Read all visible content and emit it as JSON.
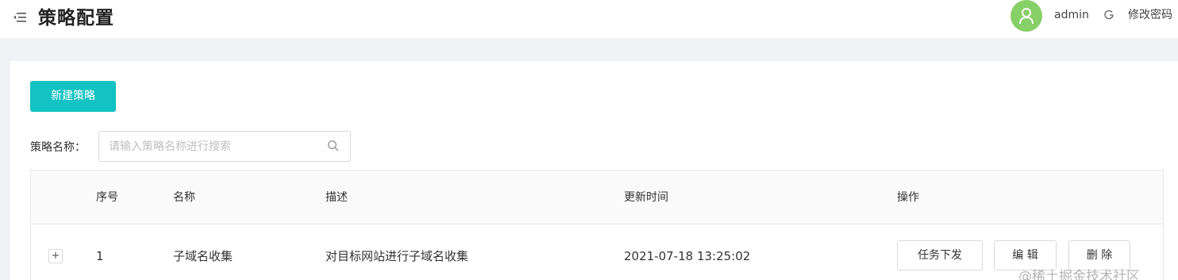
{
  "header": {
    "title": "策略配置",
    "username": "admin",
    "change_password": "修改密码",
    "avatar_color": "#87d068"
  },
  "toolbar": {
    "new_strategy_label": "新建策略",
    "accent_color": "#13c2c2"
  },
  "search": {
    "label": "策略名称：",
    "placeholder": "请输入策略名称进行搜索",
    "value": ""
  },
  "table": {
    "columns": [
      "序号",
      "名称",
      "描述",
      "更新时间",
      "操作"
    ],
    "rows": [
      {
        "expand": "+",
        "index": "1",
        "name": "子域名收集",
        "description": "对目标网站进行子域名收集",
        "updated": "2021-07-18 13:25:02",
        "actions": [
          "任务下发",
          "编 辑",
          "删 除"
        ]
      }
    ]
  },
  "watermark": "@稀土掘金技术社区"
}
